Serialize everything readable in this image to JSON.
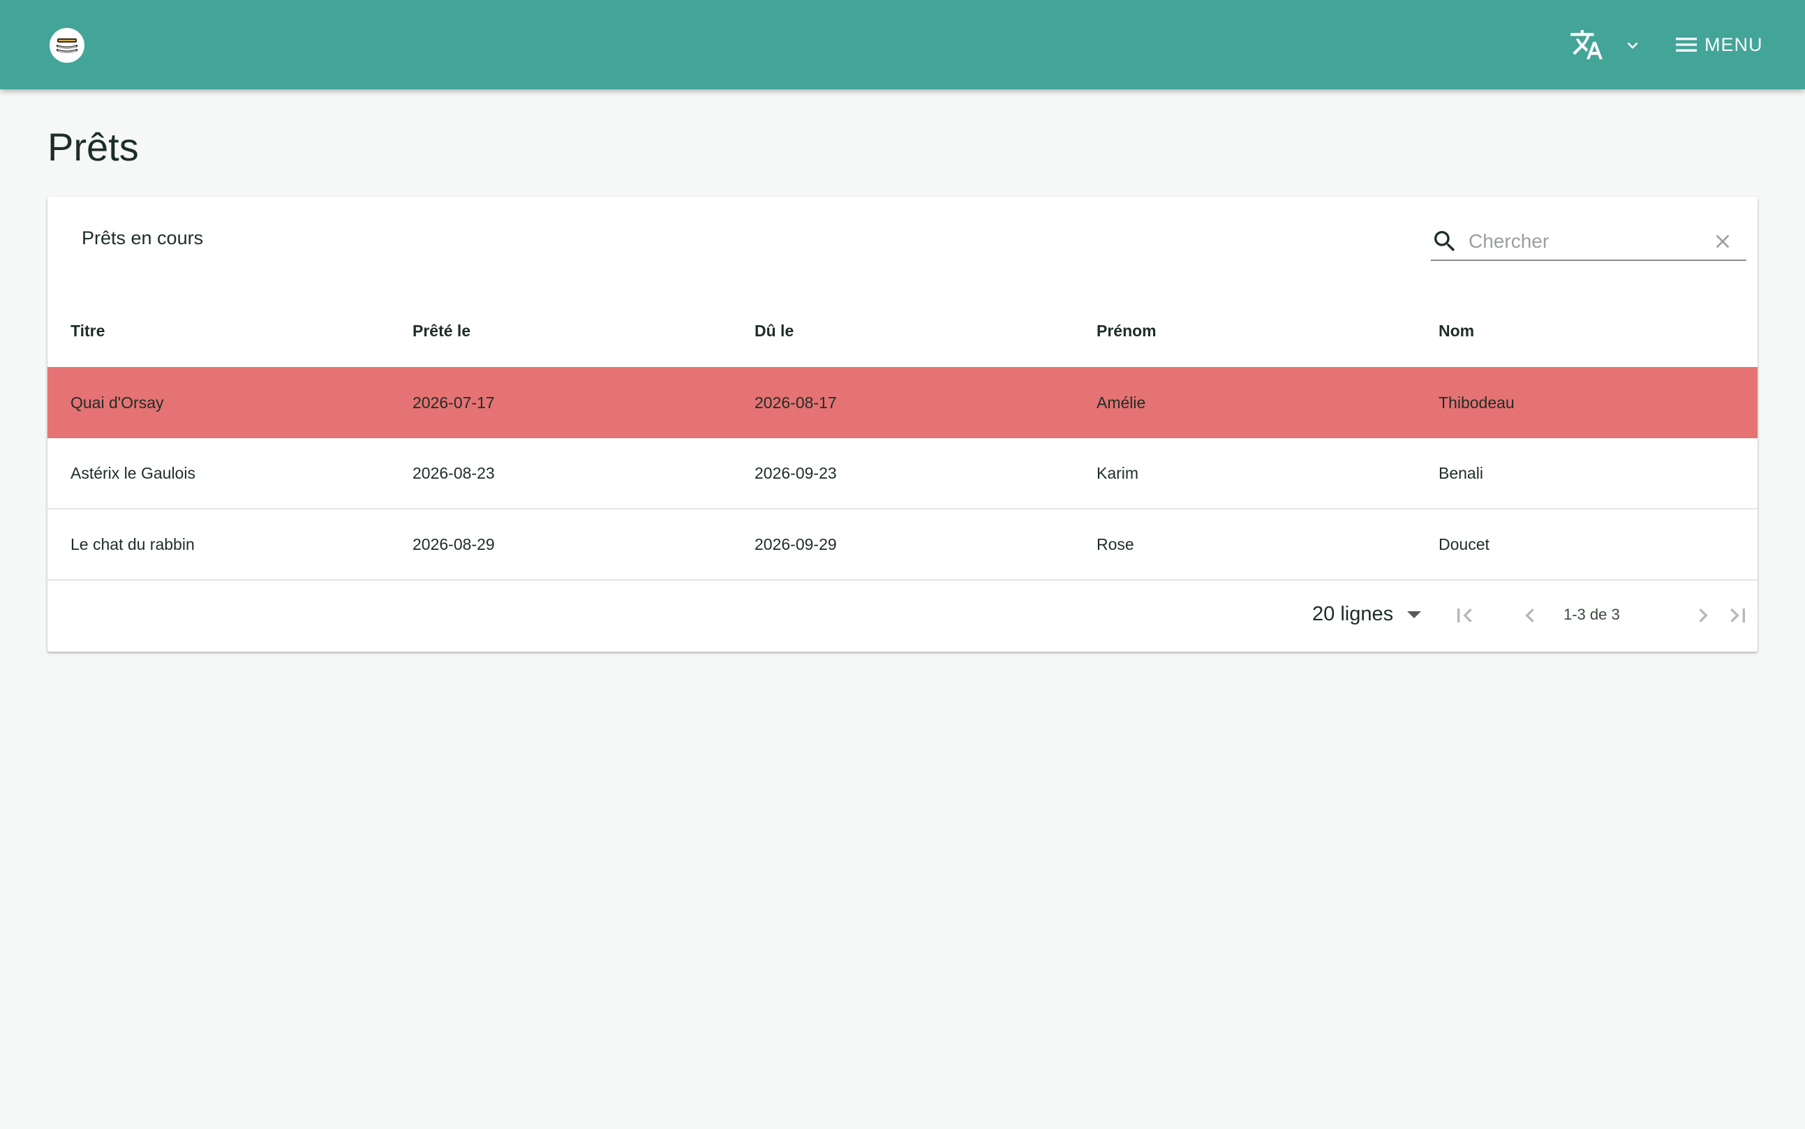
{
  "header": {
    "logo_icon": "books-icon",
    "translate_icon": "translate-icon",
    "language_dropdown_icon": "chevron-down-icon",
    "menu_icon": "hamburger-icon",
    "menu_label": "MENU",
    "background": "#43a498"
  },
  "page": {
    "title": "Prêts"
  },
  "card": {
    "title": "Prêts en cours",
    "search": {
      "placeholder": "Chercher",
      "value": ""
    }
  },
  "table": {
    "columns": [
      "Titre",
      "Prêté le",
      "Dû le",
      "Prénom",
      "Nom"
    ],
    "rows": [
      {
        "titre": "Quai d'Orsay",
        "prete_le": "2026-07-17",
        "du_le": "2026-08-17",
        "prenom": "Amélie",
        "nom": "Thibodeau",
        "overdue": true
      },
      {
        "titre": "Astérix le Gaulois",
        "prete_le": "2026-08-23",
        "du_le": "2026-09-23",
        "prenom": "Karim",
        "nom": "Benali",
        "overdue": false
      },
      {
        "titre": "Le chat du rabbin",
        "prete_le": "2026-08-29",
        "du_le": "2026-09-29",
        "prenom": "Rose",
        "nom": "Doucet",
        "overdue": false
      }
    ],
    "overdue_color": "#e57373"
  },
  "paginator": {
    "page_size_label": "20 lignes",
    "range_label": "1-3 de 3"
  }
}
